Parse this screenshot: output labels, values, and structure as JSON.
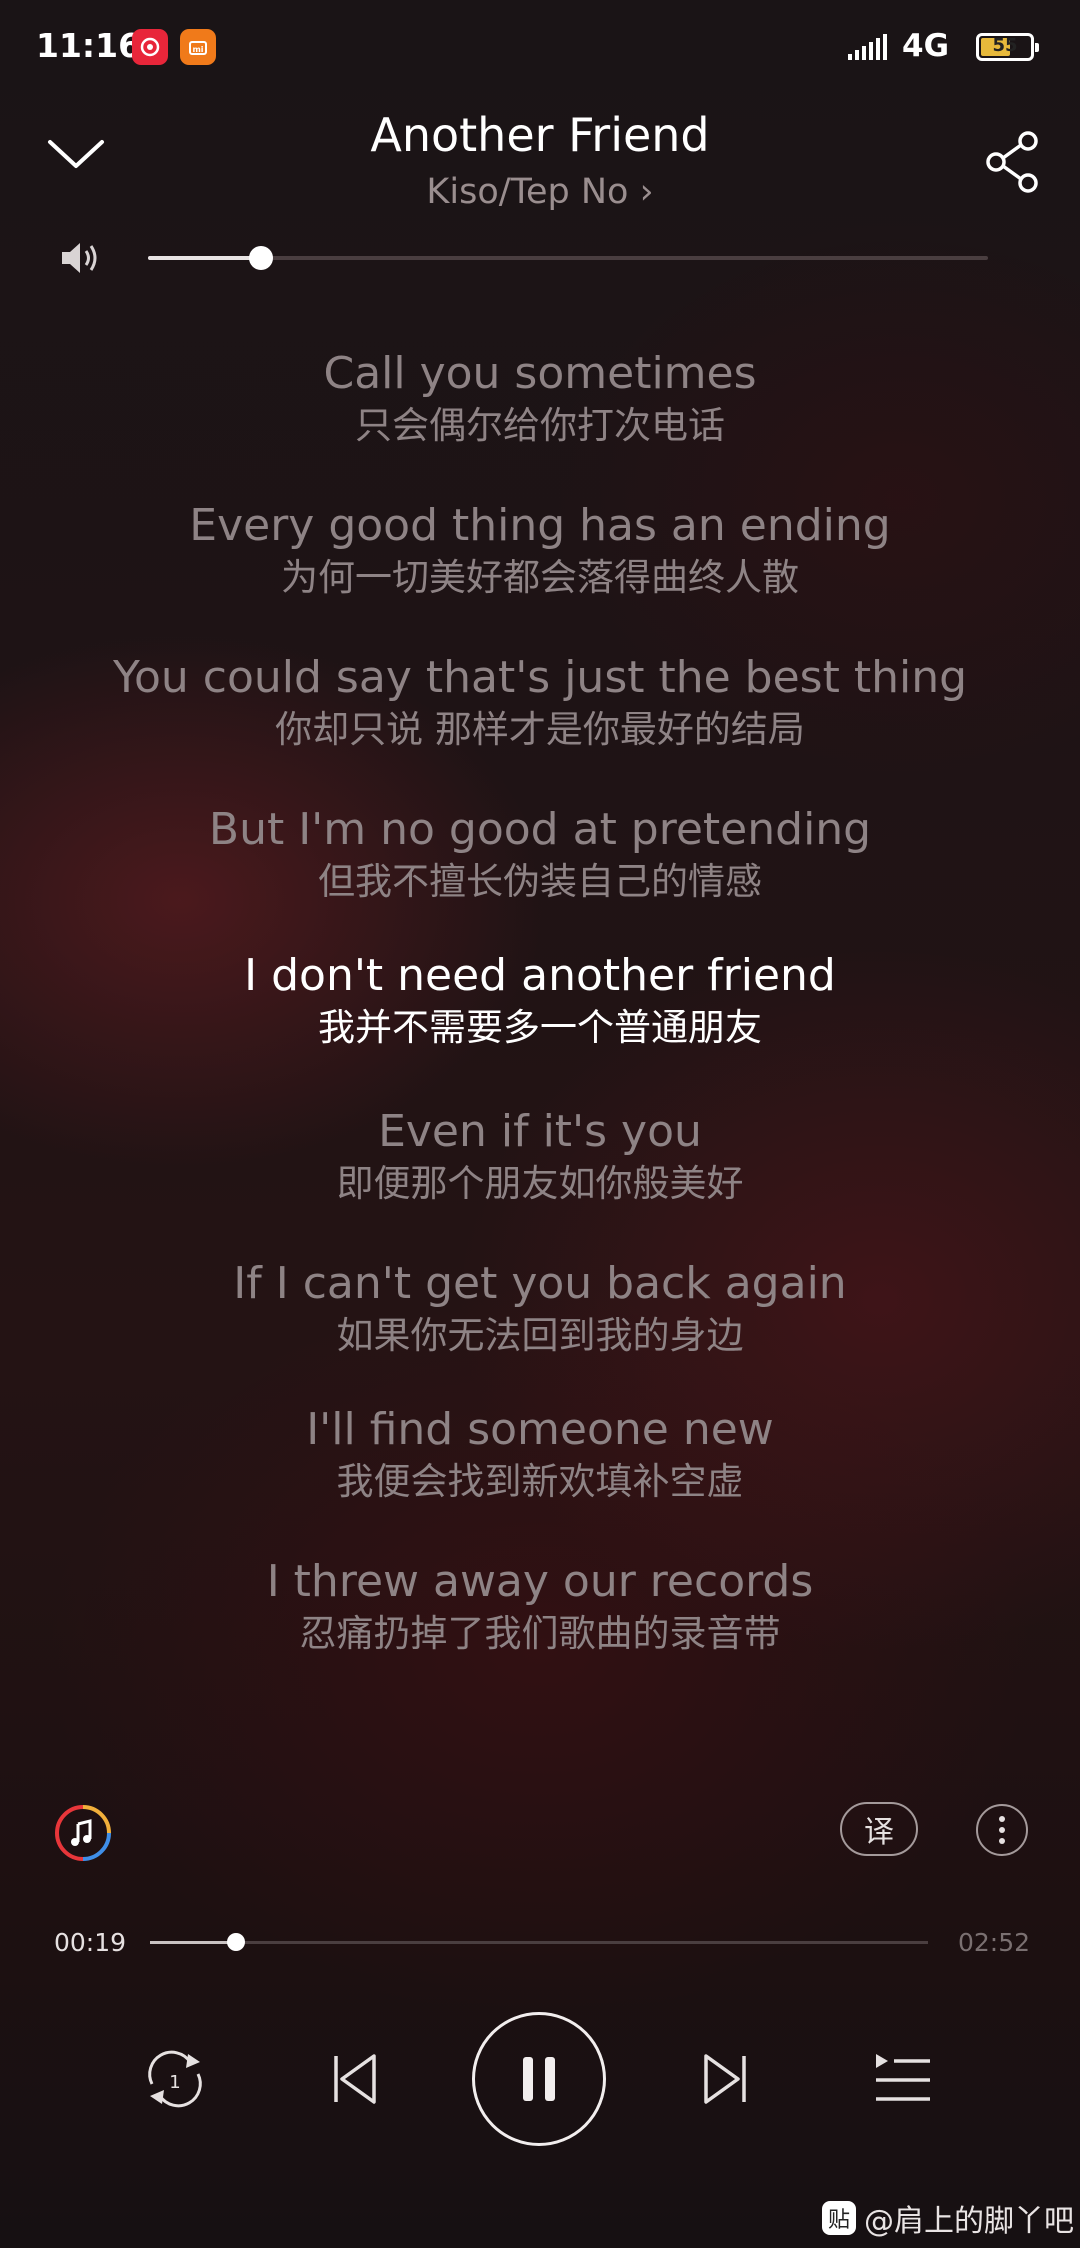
{
  "status_bar": {
    "time": "11:16",
    "network": "4G",
    "battery": "55",
    "app_icons": [
      {
        "name": "netease-music-icon",
        "color": "#e8263a"
      },
      {
        "name": "mi-store-icon",
        "color": "#f07a1a"
      }
    ]
  },
  "header": {
    "title": "Another Friend",
    "artist": "Kiso/Tep No",
    "artist_chevron": "›"
  },
  "volume": {
    "level": 0.135
  },
  "lyrics": [
    {
      "en": "Call you sometimes",
      "zh": "只会偶尔给你打次电话",
      "active": false
    },
    {
      "en": "Every good thing has an ending",
      "zh": "为何一切美好都会落得曲终人散",
      "active": false
    },
    {
      "en": "You could say that's just the best thing",
      "zh": "你却只说 那样才是你最好的结局",
      "active": false
    },
    {
      "en": "But I'm no good at pretending",
      "zh": "但我不擅长伪装自己的情感",
      "active": false
    },
    {
      "en": "I don't need another friend",
      "zh": "我并不需要多一个普通朋友",
      "active": true
    },
    {
      "en": "Even if it's you",
      "zh": "即便那个朋友如你般美好",
      "active": false
    },
    {
      "en": "If I can't get you back again",
      "zh": "如果你无法回到我的身边",
      "active": false
    },
    {
      "en": "I'll find someone new",
      "zh": "我便会找到新欢填补空虚",
      "active": false
    },
    {
      "en": "I threw away our records",
      "zh": "忍痛扔掉了我们歌曲的录音带",
      "active": false
    }
  ],
  "tools": {
    "translate_label": "译"
  },
  "progress": {
    "elapsed": "00:19",
    "total": "02:52",
    "fraction": 0.11
  },
  "colors": {
    "accent": "#ffffff",
    "muted_text": "#8e8385",
    "background": "#1e1315"
  },
  "watermark": {
    "badge": "贴",
    "text": "@肩上的脚丫吧"
  }
}
